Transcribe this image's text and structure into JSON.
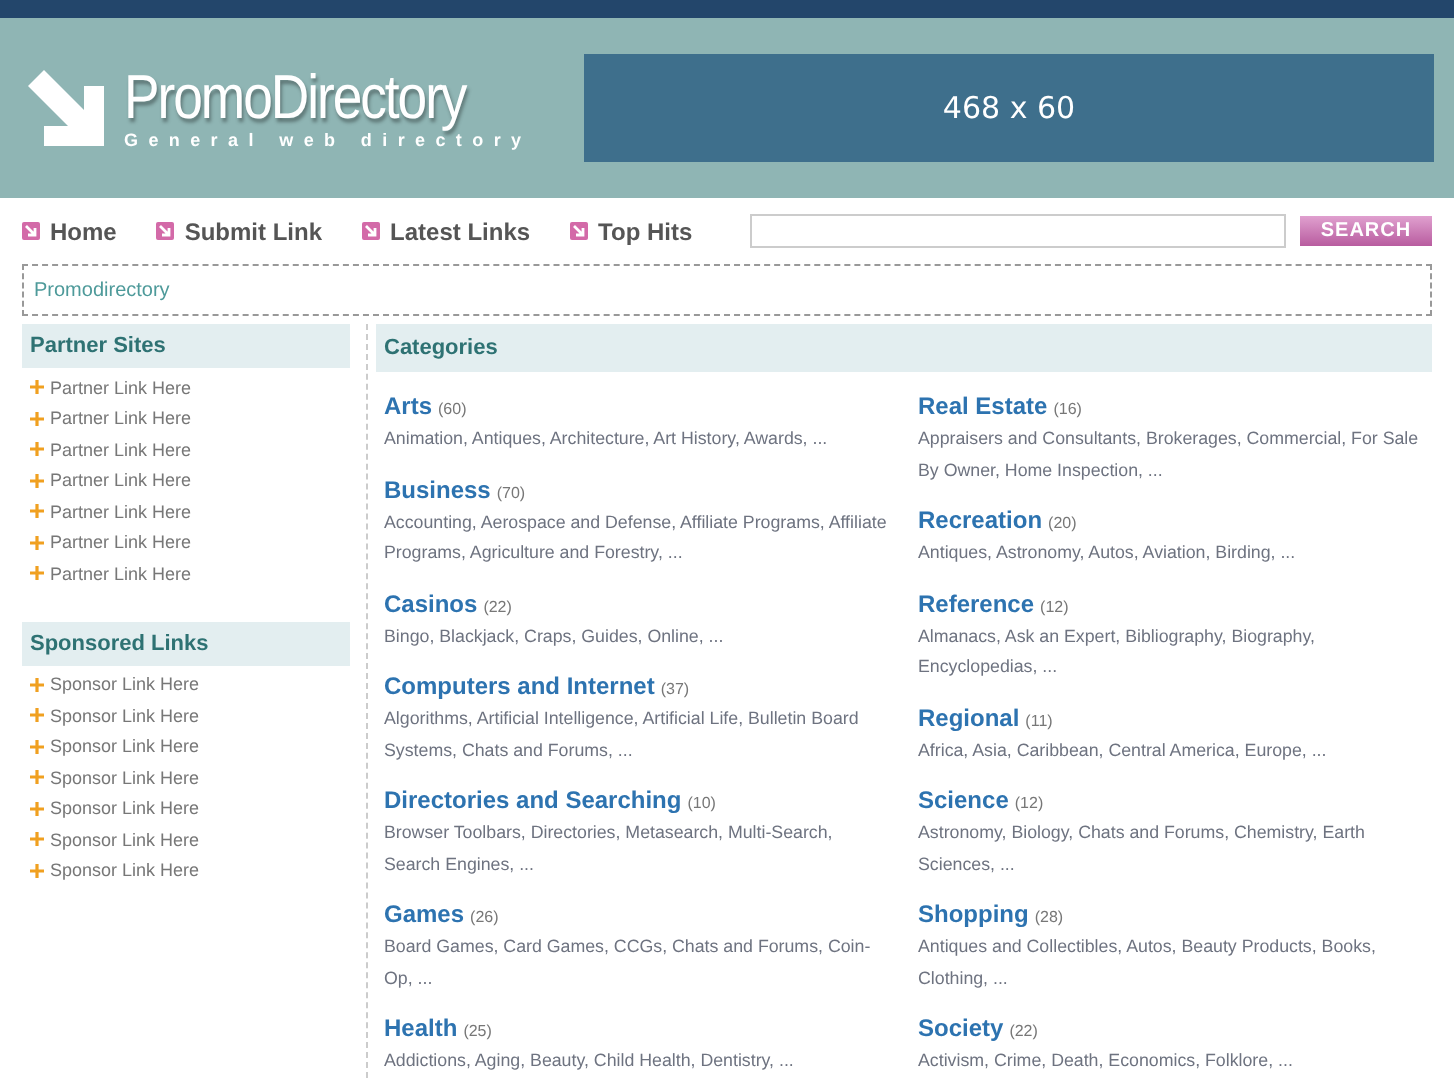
{
  "header": {
    "logo": {
      "title": "PromoDirectory",
      "subtitle": "General web directory"
    },
    "banner": "468 x 60"
  },
  "nav": [
    {
      "label": "Home"
    },
    {
      "label": "Submit Link"
    },
    {
      "label": "Latest Links"
    },
    {
      "label": "Top Hits"
    }
  ],
  "search": {
    "button": "SEARCH"
  },
  "breadcrumb": "Promodirectory",
  "sidebar": [
    {
      "title": "Partner Sites",
      "links": [
        "Partner Link Here",
        "Partner Link Here",
        "Partner Link Here",
        "Partner Link Here",
        "Partner Link Here",
        "Partner Link Here",
        "Partner Link Here"
      ]
    },
    {
      "title": "Sponsored Links",
      "links": [
        "Sponsor Link Here",
        "Sponsor Link Here",
        "Sponsor Link Here",
        "Sponsor Link Here",
        "Sponsor Link Here",
        "Sponsor Link Here",
        "Sponsor Link Here"
      ]
    }
  ],
  "categories": {
    "title": "Categories",
    "columns": [
      [
        {
          "name": "Arts",
          "count": "(60)",
          "subs": "Animation, Antiques, Architecture, Art History, Awards, ..."
        },
        {
          "name": "Business",
          "count": "(70)",
          "subs": "Accounting, Aerospace and Defense, Affiliate Programs, Affiliate Programs, Agriculture and Forestry, ..."
        },
        {
          "name": "Casinos",
          "count": "(22)",
          "subs": "Bingo, Blackjack, Craps, Guides, Online, ..."
        },
        {
          "name": "Computers and Internet",
          "count": "(37)",
          "subs": "Algorithms, Artificial Intelligence, Artificial Life, Bulletin Board Systems, Chats and Forums, ..."
        },
        {
          "name": "Directories and Searching",
          "count": "(10)",
          "subs": "Browser Toolbars, Directories, Metasearch, Multi-Search, Search Engines, ..."
        },
        {
          "name": "Games",
          "count": "(26)",
          "subs": "Board Games, Card Games, CCGs, Chats and Forums, Coin-Op, ..."
        },
        {
          "name": "Health",
          "count": "(25)",
          "subs": "Addictions, Aging, Beauty, Child Health, Dentistry, ..."
        }
      ],
      [
        {
          "name": "Real Estate",
          "count": "(16)",
          "subs": "Appraisers and Consultants, Brokerages, Commercial, For Sale By Owner, Home Inspection, ..."
        },
        {
          "name": "Recreation",
          "count": "(20)",
          "subs": "Antiques, Astronomy, Autos, Aviation, Birding, ..."
        },
        {
          "name": "Reference",
          "count": "(12)",
          "subs": "Almanacs, Ask an Expert, Bibliography, Biography, Encyclopedias, ..."
        },
        {
          "name": "Regional",
          "count": "(11)",
          "subs": "Africa, Asia, Caribbean, Central America, Europe, ..."
        },
        {
          "name": "Science",
          "count": "(12)",
          "subs": "Astronomy, Biology, Chats and Forums, Chemistry, Earth Sciences, ..."
        },
        {
          "name": "Shopping",
          "count": "(28)",
          "subs": "Antiques and Collectibles, Autos, Beauty Products, Books, Clothing, ..."
        },
        {
          "name": "Society",
          "count": "(22)",
          "subs": "Activism, Crime, Death, Economics, Folklore, ..."
        }
      ]
    ]
  }
}
